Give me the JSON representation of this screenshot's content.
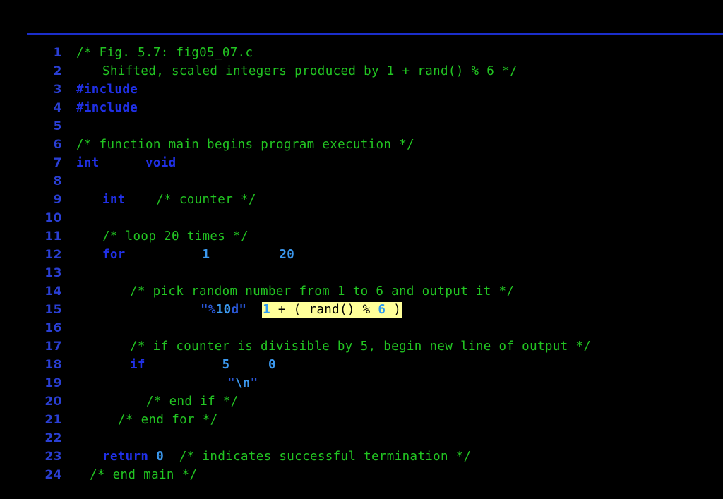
{
  "slide": {
    "background_color": "#000000",
    "rule_color": "#1b2ecb",
    "figure_title": "Fig. 5.7: fig05_07.c",
    "file_name": "fig05_07.c"
  },
  "palette": {
    "comment": "#22c522",
    "keyword": "#2030e6",
    "number": "#3b98ee",
    "string": "#2a57d8",
    "line_number": "#2a3fd4",
    "highlight_bg": "#ffff99",
    "highlight_fg": "#000000"
  },
  "code": {
    "language": "c",
    "highlighted_expression": "1 + ( rand() % 6 )",
    "highlighted_line_number": "15",
    "lines": [
      {
        "n": "1",
        "text": "/* Fig. 5.7: fig05_07.c"
      },
      {
        "n": "2",
        "text": "   Shifted, scaled integers produced by 1 + rand() % 6 */"
      },
      {
        "n": "3",
        "text": "#include"
      },
      {
        "n": "4",
        "text": "#include"
      },
      {
        "n": "5",
        "text": ""
      },
      {
        "n": "6",
        "text": "/* function main begins program execution */"
      },
      {
        "n": "7",
        "text": "int       void"
      },
      {
        "n": "8",
        "text": ""
      },
      {
        "n": "9",
        "text": "   int    /* counter */"
      },
      {
        "n": "10",
        "text": ""
      },
      {
        "n": "11",
        "text": "   /* loop 20 times */"
      },
      {
        "n": "12",
        "text": "   for       1        20"
      },
      {
        "n": "13",
        "text": ""
      },
      {
        "n": "14",
        "text": "      /* pick random number from 1 to 6 and output it */"
      },
      {
        "n": "15",
        "text": "            \"%10d\"   1 + ( rand() % 6 )"
      },
      {
        "n": "16",
        "text": ""
      },
      {
        "n": "17",
        "text": "      /* if counter is divisible by 5, begin new line of output */"
      },
      {
        "n": "18",
        "text": "      if      5    0"
      },
      {
        "n": "19",
        "text": "               \"\\n\""
      },
      {
        "n": "20",
        "text": "       /* end if */"
      },
      {
        "n": "21",
        "text": "     /* end for */"
      },
      {
        "n": "22",
        "text": ""
      },
      {
        "n": "23",
        "text": "   return 0  /* indicates successful termination */"
      },
      {
        "n": "24",
        "text": "  /* end main */"
      }
    ],
    "tokens": {
      "l1_comment": "/* Fig. 5.7: fig05_07.c",
      "l2_comment": "Shifted, scaled integers produced by 1 + rand() % 6 */",
      "l3_kw": "#include",
      "l4_kw": "#include",
      "l6_comment": "/* function main begins program execution */",
      "l7_kw_int": "int",
      "l7_kw_void": "void",
      "l9_kw_int": "int",
      "l9_comment": "/* counter */",
      "l11_comment": "/* loop 20 times */",
      "l12_kw_for": "for",
      "l12_num_1": "1",
      "l12_num_20": "20",
      "l14_comment": "/* pick random number from 1 to 6 and output it */",
      "l15_str_q1": "\"",
      "l15_str_pct": "%",
      "l15_str_10": "10",
      "l15_str_d": "d",
      "l15_str_q2": "\"",
      "l15_hl_1": "1",
      "l15_hl_plus": " + ( rand() % ",
      "l15_hl_6": "6",
      "l15_hl_close": " )",
      "l17_comment": "/* if counter is divisible by 5, begin new line of output */",
      "l18_kw_if": "if",
      "l18_num_5": "5",
      "l18_num_0": "0",
      "l19_str_q1": "\"",
      "l19_str_esc": "\\n",
      "l19_str_q2": "\"",
      "l20_comment": "/* end if */",
      "l21_comment": "/* end for */",
      "l23_kw_return": "return",
      "l23_num_0": "0",
      "l23_comment": "/* indicates successful termination */",
      "l24_comment": "/* end main */"
    }
  }
}
